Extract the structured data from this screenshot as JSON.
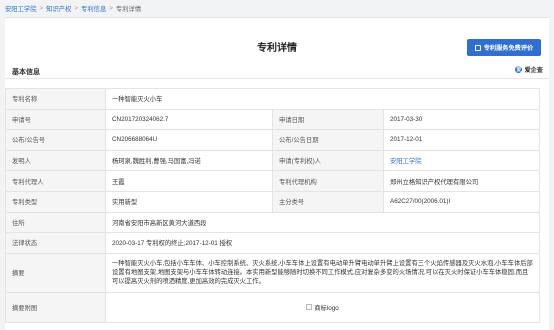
{
  "breadcrumb": {
    "items": [
      "安阳工学院",
      "知识产权",
      "专利信息"
    ],
    "current": "专利详情",
    "separator": ">"
  },
  "page": {
    "title": "专利详情",
    "evaluate_button": "专利服务免费评价",
    "section_title": "基本信息",
    "source_logo": "爱企查"
  },
  "patent": {
    "name_label": "专利名称",
    "name": "一种智能灭火小车",
    "app_no_label": "申请号",
    "app_no": "CN201720324062.7",
    "app_date_label": "申请日期",
    "app_date": "2017-03-30",
    "pub_no_label": "公布/公告号",
    "pub_no": "CN206688064U",
    "pub_date_label": "公布/公告日期",
    "pub_date": "2017-12-01",
    "inventor_label": "发明人",
    "inventor": "杨珂泉,魏胜利,曹强,马国富,冯诺",
    "applicant_label": "申请(专利权)人",
    "applicant": "安阳工学院",
    "agent_label": "专利代理人",
    "agent": "王霞",
    "agency_label": "专利代理机构",
    "agency": "郑州立格知识产权代理有限公司",
    "type_label": "专利类型",
    "type": "实用新型",
    "class_label": "主分类号",
    "class": "A62C27/00(2006.01)I",
    "address_label": "住所",
    "address": "河南省安阳市高新区黄河大道西段",
    "legal_label": "法律状态",
    "legal": "2020-03-17 专利权的终止;2017-12-01 授权",
    "abstract_label": "摘要",
    "abstract": "一种智能灭火小车,包括小车车体、小车控制系统、灭火系统,小车车体上设置有电动单升臂电动单升臂上设置有三个火焰传感器及灭火水泡,小车车体后部设置有地图支架,地图支架与小车车体转动连接。本实用新型能够随时切换不同工作模式,应对复杂多变的火场情况,可以在灭火时保证小车车体稳固,而且可以提高灭火剂的喷洒精度,更加高效的完成灭火工作。",
    "drawing_label": "摘要附图",
    "drawing_alt": "商标logo"
  }
}
